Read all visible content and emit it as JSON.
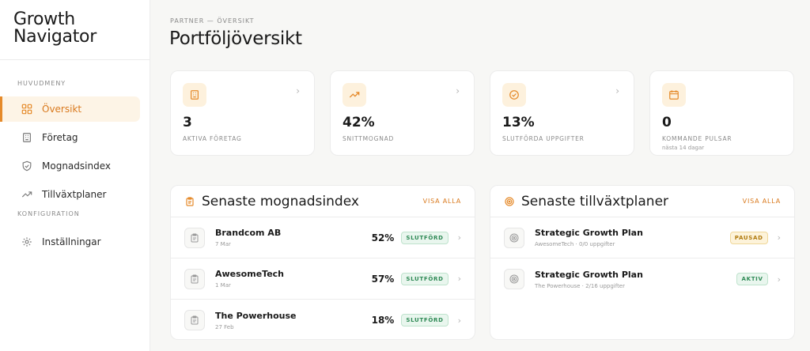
{
  "brand": {
    "line1": "Growth",
    "line2": "Navigator"
  },
  "sidebar": {
    "main_label": "HUVUDMENY",
    "items": [
      {
        "label": "Översikt",
        "icon": "grid-icon",
        "active": true
      },
      {
        "label": "Företag",
        "icon": "building-icon"
      },
      {
        "label": "Mognadsindex",
        "icon": "shield-icon"
      },
      {
        "label": "Tillväxtplaner",
        "icon": "trend-up-icon"
      }
    ],
    "config_label": "KONFIGURATION",
    "config_items": [
      {
        "label": "Inställningar",
        "icon": "gear-icon"
      }
    ]
  },
  "header": {
    "breadcrumb": "PARTNER — ÖVERSIKT",
    "title": "Portföljöversikt"
  },
  "stats": [
    {
      "value": "3",
      "label": "AKTIVA FÖRETAG",
      "icon": "building-icon",
      "has_link": true
    },
    {
      "value": "42%",
      "label": "SNITTMOGNAD",
      "icon": "trend-up-icon",
      "has_link": true
    },
    {
      "value": "13%",
      "label": "SLUTFÖRDA UPPGIFTER",
      "icon": "check-circle-icon",
      "has_link": true
    },
    {
      "value": "0",
      "label": "KOMMANDE PULSAR",
      "sub": "nästa 14 dagar",
      "icon": "calendar-icon",
      "has_link": false
    }
  ],
  "maturity_panel": {
    "title": "Senaste mognadsindex",
    "view_all": "VISA ALLA",
    "rows": [
      {
        "name": "Brandcom AB",
        "meta": "7 Mar",
        "percent": "52%",
        "status": "SLUTFÖRD"
      },
      {
        "name": "AwesomeTech",
        "meta": "1 Mar",
        "percent": "57%",
        "status": "SLUTFÖRD"
      },
      {
        "name": "The Powerhouse",
        "meta": "27 Feb",
        "percent": "18%",
        "status": "SLUTFÖRD"
      }
    ]
  },
  "plans_panel": {
    "title": "Senaste tillväxtplaner",
    "view_all": "VISA ALLA",
    "rows": [
      {
        "name": "Strategic Growth Plan",
        "meta": "AwesomeTech · 0/0 uppgifter",
        "status": "PAUSAD"
      },
      {
        "name": "Strategic Growth Plan",
        "meta": "The Powerhouse · 2/16 uppgifter",
        "status": "AKTIV"
      }
    ]
  },
  "colors": {
    "accent": "#e58a2a",
    "accent_bg": "#fdf1dd",
    "success": "#2f8a56",
    "warning": "#b07a0e"
  }
}
